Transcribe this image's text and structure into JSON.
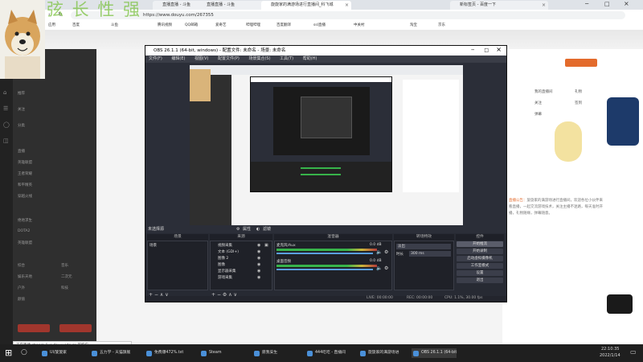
{
  "browser": {
    "tabs": [
      {
        "label": "直播直播 - 斗鱼"
      },
      {
        "label": "直播直播 - 斗鱼"
      },
      {
        "label": "旋旋家的满游场进行直播间_科飞城"
      },
      {
        "label": "新标签页"
      }
    ],
    "url": "https://www.douyu.com/267355",
    "bookmarks": [
      "应用",
      "百度",
      "斗鱼",
      "腾讯视频",
      "QQ邮箱",
      "爱奇艺",
      "哔哩哔哩",
      "百度翻译",
      "ssl直播",
      "中关村",
      "淘宝",
      "京东"
    ],
    "right_tab": "新标签页 - 百度一下"
  },
  "overlay_text": "弦 长 性 强",
  "site": {
    "left_items": [
      "推荐",
      "关注",
      "分类",
      "直播",
      "英雄联盟",
      "王者荣耀",
      "和平精英",
      "穿越火线",
      "绝地求生",
      "DOTA2",
      "英雄联盟",
      "综合",
      "娱乐天地",
      "户外",
      "颜值",
      "音乐",
      "二次元",
      "科技"
    ],
    "right_info": [
      "我的直播间",
      "关注",
      "弹幕",
      "礼物",
      "签到"
    ],
    "notice_label": "直播公告：",
    "notice_text": "旋旋家的满游场进行直播间，欢迎各位小伙伴来看直播，一起交流游戏技术，关注主播不迷路，每天准时开播，礼物随缘，弹幕随意。"
  },
  "obs": {
    "title": "OBS 26.1.1 (64-bit, windows) - 配置文件: 未命名 - 场景: 未命名",
    "menu": [
      "文件(F)",
      "编辑(E)",
      "视图(V)",
      "配置文件(P)",
      "场景集合(S)",
      "工具(T)",
      "帮助(H)"
    ],
    "no_source": "未选择源",
    "props_btn": "属性",
    "filters_btn": "滤镜",
    "dock_titles": {
      "scenes": "场景",
      "sources": "来源",
      "mixer": "混音器",
      "transitions": "转场特效",
      "controls": "控件"
    },
    "scenes": [
      "场景"
    ],
    "sources": [
      "视频采集",
      "文本 (GDI+)",
      "图像 2",
      "图像",
      "显示器采集",
      "游戏采集"
    ],
    "mixer": [
      {
        "name": "麦克风/Aux",
        "db": "0.0 dB"
      },
      {
        "name": "桌面音频",
        "db": "0.0 dB"
      }
    ],
    "transition": {
      "type": "淡出",
      "duration_label": "时长",
      "duration": "300 ms"
    },
    "controls": [
      "开始推流",
      "开始录制",
      "启动虚拟摄像机",
      "工作室模式",
      "设置",
      "退出"
    ],
    "status": {
      "live": "LIVE: 00:00:00",
      "rec": "REC: 00:00:00",
      "cpu": "CPU: 1.1%, 30.00 fps"
    }
  },
  "taskbar": {
    "tooltip": "正在等待 stream-live.douyucdn.cn 的响应...",
    "tasks": [
      "UI/旋旋家",
      "五力学 - 天猫旗舰",
      "免费爆472%.txt",
      "Steam",
      "愿我安生",
      "444吃吃 - 直播间",
      "旋旋家的满游场进",
      "OBS 26.1.1 (64-bit"
    ],
    "time": "22:10:35",
    "date": "2022/1/14"
  },
  "colors": {
    "accent": "#e36b2c",
    "obs_bg": "#2b2e38",
    "overlay_green": "#7cc241"
  }
}
